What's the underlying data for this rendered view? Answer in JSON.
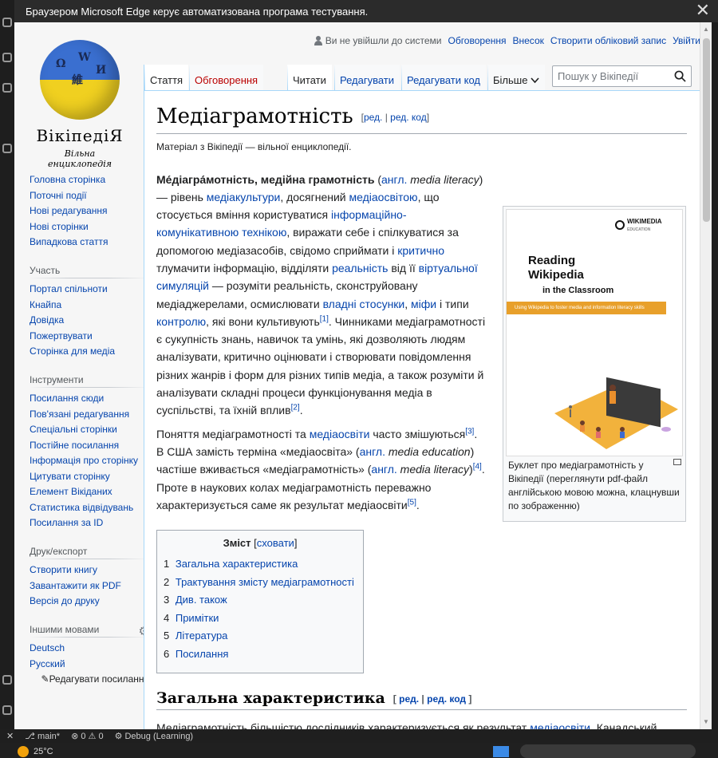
{
  "automation_bar": {
    "text": "Браузером Microsoft Edge керує автоматизована програма тестування.",
    "close": "✕"
  },
  "logo": {
    "wordmark": "ВікіпедіЯ",
    "tagline": "Вільна енциклопедія",
    "pieces": [
      "Ω",
      "W",
      "И",
      "維"
    ]
  },
  "personal": {
    "not_logged_in": "Ви не увійшли до системи",
    "links": [
      "Обговорення",
      "Внесок",
      "Створити обліковий запис",
      "Увійти"
    ]
  },
  "tabs": {
    "article": "Стаття",
    "talk": "Обговорення",
    "read": "Читати",
    "edit": "Редагувати",
    "edit_source": "Редагувати код",
    "more": "Більше"
  },
  "search": {
    "placeholder": "Пошук у Вікіпедії"
  },
  "sidebar": {
    "nav": [
      "Головна сторінка",
      "Поточні події",
      "Нові редагування",
      "Нові сторінки",
      "Випадкова стаття"
    ],
    "participation": {
      "title": "Участь",
      "items": [
        "Портал спільноти",
        "Кнайпа",
        "Довідка",
        "Пожертвувати",
        "Сторінка для медіа"
      ]
    },
    "tools": {
      "title": "Інструменти",
      "items": [
        "Посилання сюди",
        "Пов'язані редагування",
        "Спеціальні сторінки",
        "Постійне посилання",
        "Інформація про сторінку",
        "Цитувати сторінку",
        "Елемент Вікіданих",
        "Статистика відвідувань",
        "Посилання за ID"
      ]
    },
    "print": {
      "title": "Друк/експорт",
      "items": [
        "Створити книгу",
        "Завантажити як PDF",
        "Версія до друку"
      ]
    },
    "languages": {
      "title": "Іншими мовами",
      "items": [
        "Deutsch",
        "Русский"
      ],
      "edit_links": "Редагувати посилання"
    }
  },
  "article": {
    "title": "Медіаграмотність",
    "edit": "ред.",
    "edit_source": "ред. код",
    "site_sub": "Матеріал з Вікіпедії — вільної енциклопедії.",
    "p1": {
      "bold": "Ме́діагра́мотність, медійна грамотність",
      "t1": " (",
      "l_angl": "англ.",
      "t2_it": " media literacy",
      "t3": ") — рівень ",
      "l1": "медіакультури",
      "t4": ", досягнений ",
      "l2": "медіаосвітою",
      "t5": ", що стосується вміння користуватися ",
      "l3": "інформаційно-комунікативною технікою",
      "t6": ", виражати себе і спілкуватися за допомогою медіазасобів, свідомо сприймати і ",
      "l4": "критично",
      "t7": " тлумачити інформацію, відділяти ",
      "l5": "реальність",
      "t8": " від її ",
      "l6": "віртуальної симуляцій",
      "t9": " — розуміти реальність, сконструйовану медіаджерелами, осмислювати ",
      "l7": "владні стосунки",
      "t10": ", ",
      "l8": "міфи",
      "t11": " і типи ",
      "l9": "контролю",
      "t12": ", які вони культивують",
      "ref1": "[1]",
      "t13": ". Чинниками медіаграмотності є сукупність знань, навичок та умінь, які дозволяють людям аналізувати, критично оцінювати і створювати повідомлення різних жанрів і форм для різних типів медіа, а також розуміти й аналізувати складні процеси функціонування медіа в суспільстві, та їхній вплив",
      "ref2": "[2]",
      "t14": "."
    },
    "p2": {
      "t1": "Поняття медіаграмотності та ",
      "l1": "медіаосвіти",
      "t2": " часто змішуються",
      "ref3": "[3]",
      "t3": ". В США замість терміна «медіаосвіта» (",
      "l_angl": "англ.",
      "t4_it": " media education",
      "t5": ") частіше вживається «медіаграмотність» (",
      "l_angl2": "англ.",
      "t6_it": " media literacy",
      "t7": ")",
      "ref4": "[4]",
      "t8": ". Проте в наукових колах медіаграмотність переважно характеризується саме як результат медіаосвіти",
      "ref5": "[5]",
      "t9": "."
    },
    "thumb": {
      "brand": "WIKIMEDIA",
      "brand_sub": "EDUCATION",
      "title_line1": "Reading",
      "title_line2": "Wikipedia",
      "title_line3": "in the Classroom",
      "bar_text": "Using Wikipedia to foster media and information literacy skills",
      "caption": "Буклет про медіаграмотність у Вікіпедії (переглянути pdf-файл англійською мовою можна, клацнувши по зображенню)"
    },
    "toc": {
      "title": "Зміст",
      "hide": "сховати",
      "items": [
        {
          "num": "1",
          "label": "Загальна характеристика"
        },
        {
          "num": "2",
          "label": "Трактування змісту медіаграмотності"
        },
        {
          "num": "3",
          "label": "Див. також"
        },
        {
          "num": "4",
          "label": "Примітки"
        },
        {
          "num": "5",
          "label": "Література"
        },
        {
          "num": "6",
          "label": "Посилання"
        }
      ]
    },
    "section1": {
      "title": "Загальна характеристика",
      "text_start": "Медіаграмотність більшістю дослідників характеризується як результат ",
      "link": "медіаосвіти",
      "text_end": ". Канадський"
    }
  },
  "status_bar": {
    "branch": "main*",
    "errors": "⊗ 0 ⚠ 0",
    "debug": "Debug (Learning)"
  },
  "taskbar": {
    "weather": "25°C"
  },
  "colors": {
    "link": "#0645ad",
    "new_link": "#ba0000",
    "tab_border": "#a7d7f9"
  }
}
